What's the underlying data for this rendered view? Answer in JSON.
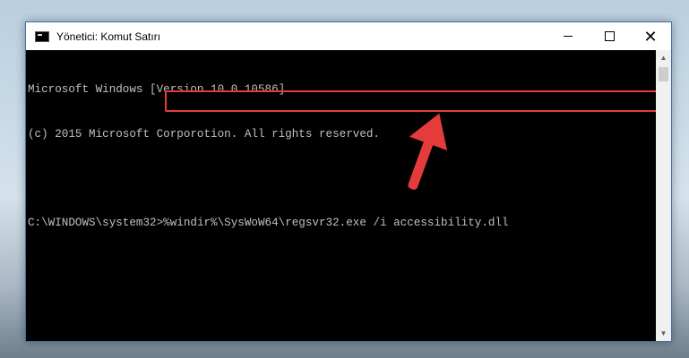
{
  "window": {
    "title": "Yönetici: Komut Satırı",
    "controls": {
      "minimize": "—",
      "maximize": "☐",
      "close": "✕"
    }
  },
  "console": {
    "lines": [
      "Microsoft Windows [Version 10.0.10586]",
      "(c) 2015 Microsoft Corporotion. All rights reserved.",
      ""
    ],
    "prompt": "C:\\WINDOWS\\system32>",
    "command": "%windir%\\SysWoW64\\regsvr32.exe /i accessibility.dll"
  },
  "scrollbar": {
    "up_arrow": "▲",
    "down_arrow": "▼"
  },
  "annotation": {
    "highlight_color": "#e53b3b",
    "arrow_color": "#e53b3b"
  },
  "icons": [
    "cmd-icon",
    "minimize-icon",
    "maximize-icon",
    "close-icon",
    "red-arrow-icon"
  ]
}
